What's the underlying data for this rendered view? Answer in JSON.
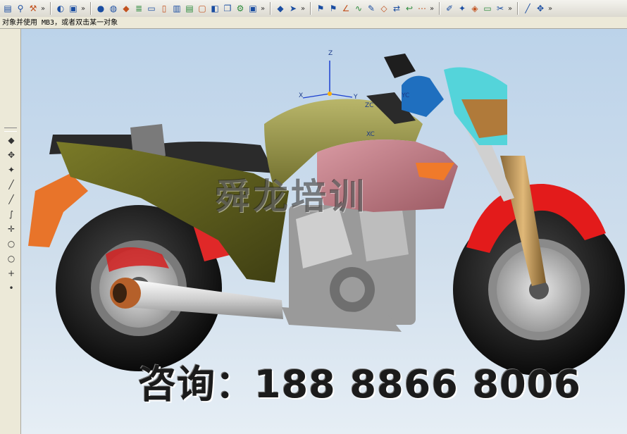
{
  "toolbar": {
    "groups": [
      {
        "name": "file-group",
        "icons": [
          "book-icon",
          "pin-icon",
          "wrench-icon"
        ]
      },
      {
        "name": "render-group",
        "icons": [
          "shading-icon",
          "box-icon"
        ]
      },
      {
        "name": "view-group",
        "icons": [
          "sphere-icon",
          "globe-icon",
          "cube-icon",
          "layer-icon",
          "sheet-icon",
          "page-icon",
          "stack-icon",
          "book-icon",
          "frame-icon",
          "fill-icon",
          "copy-icon",
          "tools-icon",
          "box-icon"
        ]
      },
      {
        "name": "edit-group",
        "icons": [
          "cube-icon",
          "arrow-icon"
        ]
      },
      {
        "name": "curve-group",
        "icons": [
          "flag-icon",
          "flag-icon",
          "angle-icon",
          "wave-icon",
          "pencil-icon",
          "diamond-icon",
          "swap-icon",
          "hook-icon",
          "dots-icon"
        ]
      },
      {
        "name": "extra-group",
        "icons": [
          "edit-icon",
          "star-icon",
          "cube-color-icon",
          "sheet-icon",
          "scissors-icon"
        ]
      },
      {
        "name": "misc-group",
        "icons": [
          "pen-icon",
          "move-icon"
        ]
      }
    ],
    "more_label": "»"
  },
  "prompt": {
    "text": "对象并使用 MB3，或者双击某一对象"
  },
  "left_tools": {
    "icons": [
      "cube-icon",
      "move-icon",
      "star-icon",
      "line-icon",
      "line-icon",
      "curve-icon",
      "cross-icon",
      "circle-icon",
      "circle-icon",
      "plus-icon",
      "dot-icon"
    ]
  },
  "viewport": {
    "watermark_title": "舜龙培训",
    "watermark_phone": "咨询：188 8866 8006",
    "axis": {
      "z": "Z",
      "x": "X",
      "y": "Y",
      "zc": "ZC",
      "yc": "YC",
      "xc": "XC"
    }
  },
  "colors": {
    "viewport_top": "#bcd3ea",
    "viewport_bottom": "#e6eef5",
    "tank": "#8e8d3f",
    "cowl": "#c8808a",
    "fender": "#e01b1b",
    "headlight": "#54d4da",
    "tire": "#1a1a1a"
  }
}
